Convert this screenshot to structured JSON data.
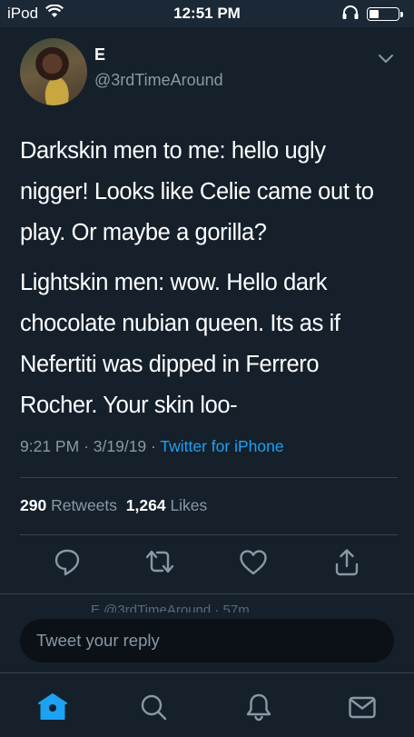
{
  "status_bar": {
    "carrier": "iPod",
    "time": "12:51 PM"
  },
  "tweet": {
    "author_name": "E",
    "author_handle": "@3rdTimeAround",
    "paragraphs": [
      "Darkskin men to me: hello ugly nigger! Looks like Celie came out to play. Or maybe a gorilla?",
      "Lightskin men: wow. Hello dark chocolate nubian queen. Its as if Nefertiti was dipped in Ferrero Rocher. Your skin loo-"
    ],
    "time": "9:21 PM",
    "separator": "·",
    "date": "3/19/19",
    "source": "Twitter for iPhone",
    "retweet_count": "290",
    "retweet_label": "Retweets",
    "like_count": "1,264",
    "like_label": "Likes"
  },
  "partial_row_text": "E @3rdTimeAround · 57m",
  "reply": {
    "placeholder": "Tweet your reply"
  },
  "icons": {
    "actions": [
      "reply-icon",
      "retweet-icon",
      "like-icon",
      "share-icon"
    ],
    "tabs": [
      "home-icon",
      "search-icon",
      "notifications-icon",
      "messages-icon"
    ]
  },
  "colors": {
    "background": "#15202b",
    "accent": "#1da1f2",
    "secondary_text": "#8899a6",
    "divider": "#38444d"
  }
}
